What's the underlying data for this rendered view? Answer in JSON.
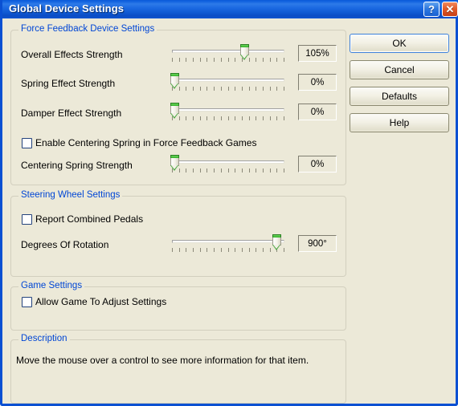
{
  "window": {
    "title": "Global Device Settings",
    "help_button_glyph": "?",
    "close_button_glyph": "✕"
  },
  "groups": {
    "force_feedback": {
      "title": "Force Feedback Device Settings",
      "sliders": [
        {
          "label": "Overall Effects Strength",
          "value_text": "105%",
          "percent": 64
        },
        {
          "label": "Spring Effect Strength",
          "value_text": "0%",
          "percent": 2
        },
        {
          "label": "Damper Effect Strength",
          "value_text": "0%",
          "percent": 2
        }
      ],
      "checkbox": {
        "label": "Enable Centering Spring in Force Feedback Games",
        "checked": false
      },
      "centering_slider": {
        "label": "Centering Spring Strength",
        "value_text": "0%",
        "percent": 2
      }
    },
    "steering_wheel": {
      "title": "Steering Wheel Settings",
      "checkbox": {
        "label": "Report Combined Pedals",
        "checked": false
      },
      "slider": {
        "label": "Degrees Of Rotation",
        "value_text": "900°",
        "percent": 93
      }
    },
    "game": {
      "title": "Game Settings",
      "checkbox": {
        "label": "Allow Game To Adjust Settings",
        "checked": false
      }
    },
    "description": {
      "title": "Description",
      "text": "Move the mouse over a control to see more information for that item."
    }
  },
  "buttons": {
    "ok": "OK",
    "cancel": "Cancel",
    "defaults": "Defaults",
    "help": "Help"
  },
  "colors": {
    "titlebar_blue": "#0a50d2",
    "group_title_blue": "#0046d5",
    "dialog_face": "#ece9d8",
    "thumb_green": "#35b02b"
  }
}
